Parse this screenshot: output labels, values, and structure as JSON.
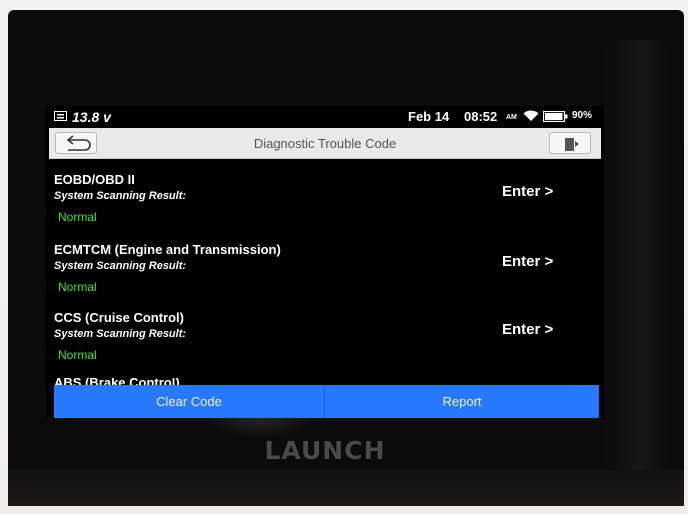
{
  "status_bar": {
    "voltage": "13.8 v",
    "date": "Feb 14",
    "time": "08:52",
    "ampm": "AM",
    "battery": "90%"
  },
  "header": {
    "title": "Diagnostic Trouble Code",
    "back_icon": "back-arrow-icon",
    "exit_icon": "exit-icon"
  },
  "systems": [
    {
      "name": "EOBD/OBD II",
      "result_label": "System Scanning Result:",
      "status": "Normal",
      "enter": "Enter >"
    },
    {
      "name": "ECMTCM (Engine and Transmission)",
      "result_label": "System Scanning Result:",
      "status": "Normal",
      "enter": "Enter >"
    },
    {
      "name": "CCS (Cruise Control)",
      "result_label": "System Scanning Result:",
      "status": "Normal",
      "enter": "Enter >"
    }
  ],
  "partial_system": "ABS (Brake Control)",
  "actions": {
    "clear_code": "Clear Code",
    "report": "Report"
  },
  "brand": "LAUNCH",
  "colors": {
    "accent": "#2979ff",
    "status_ok": "#41e23a",
    "title_bar_bg": "#e9e9e9"
  }
}
